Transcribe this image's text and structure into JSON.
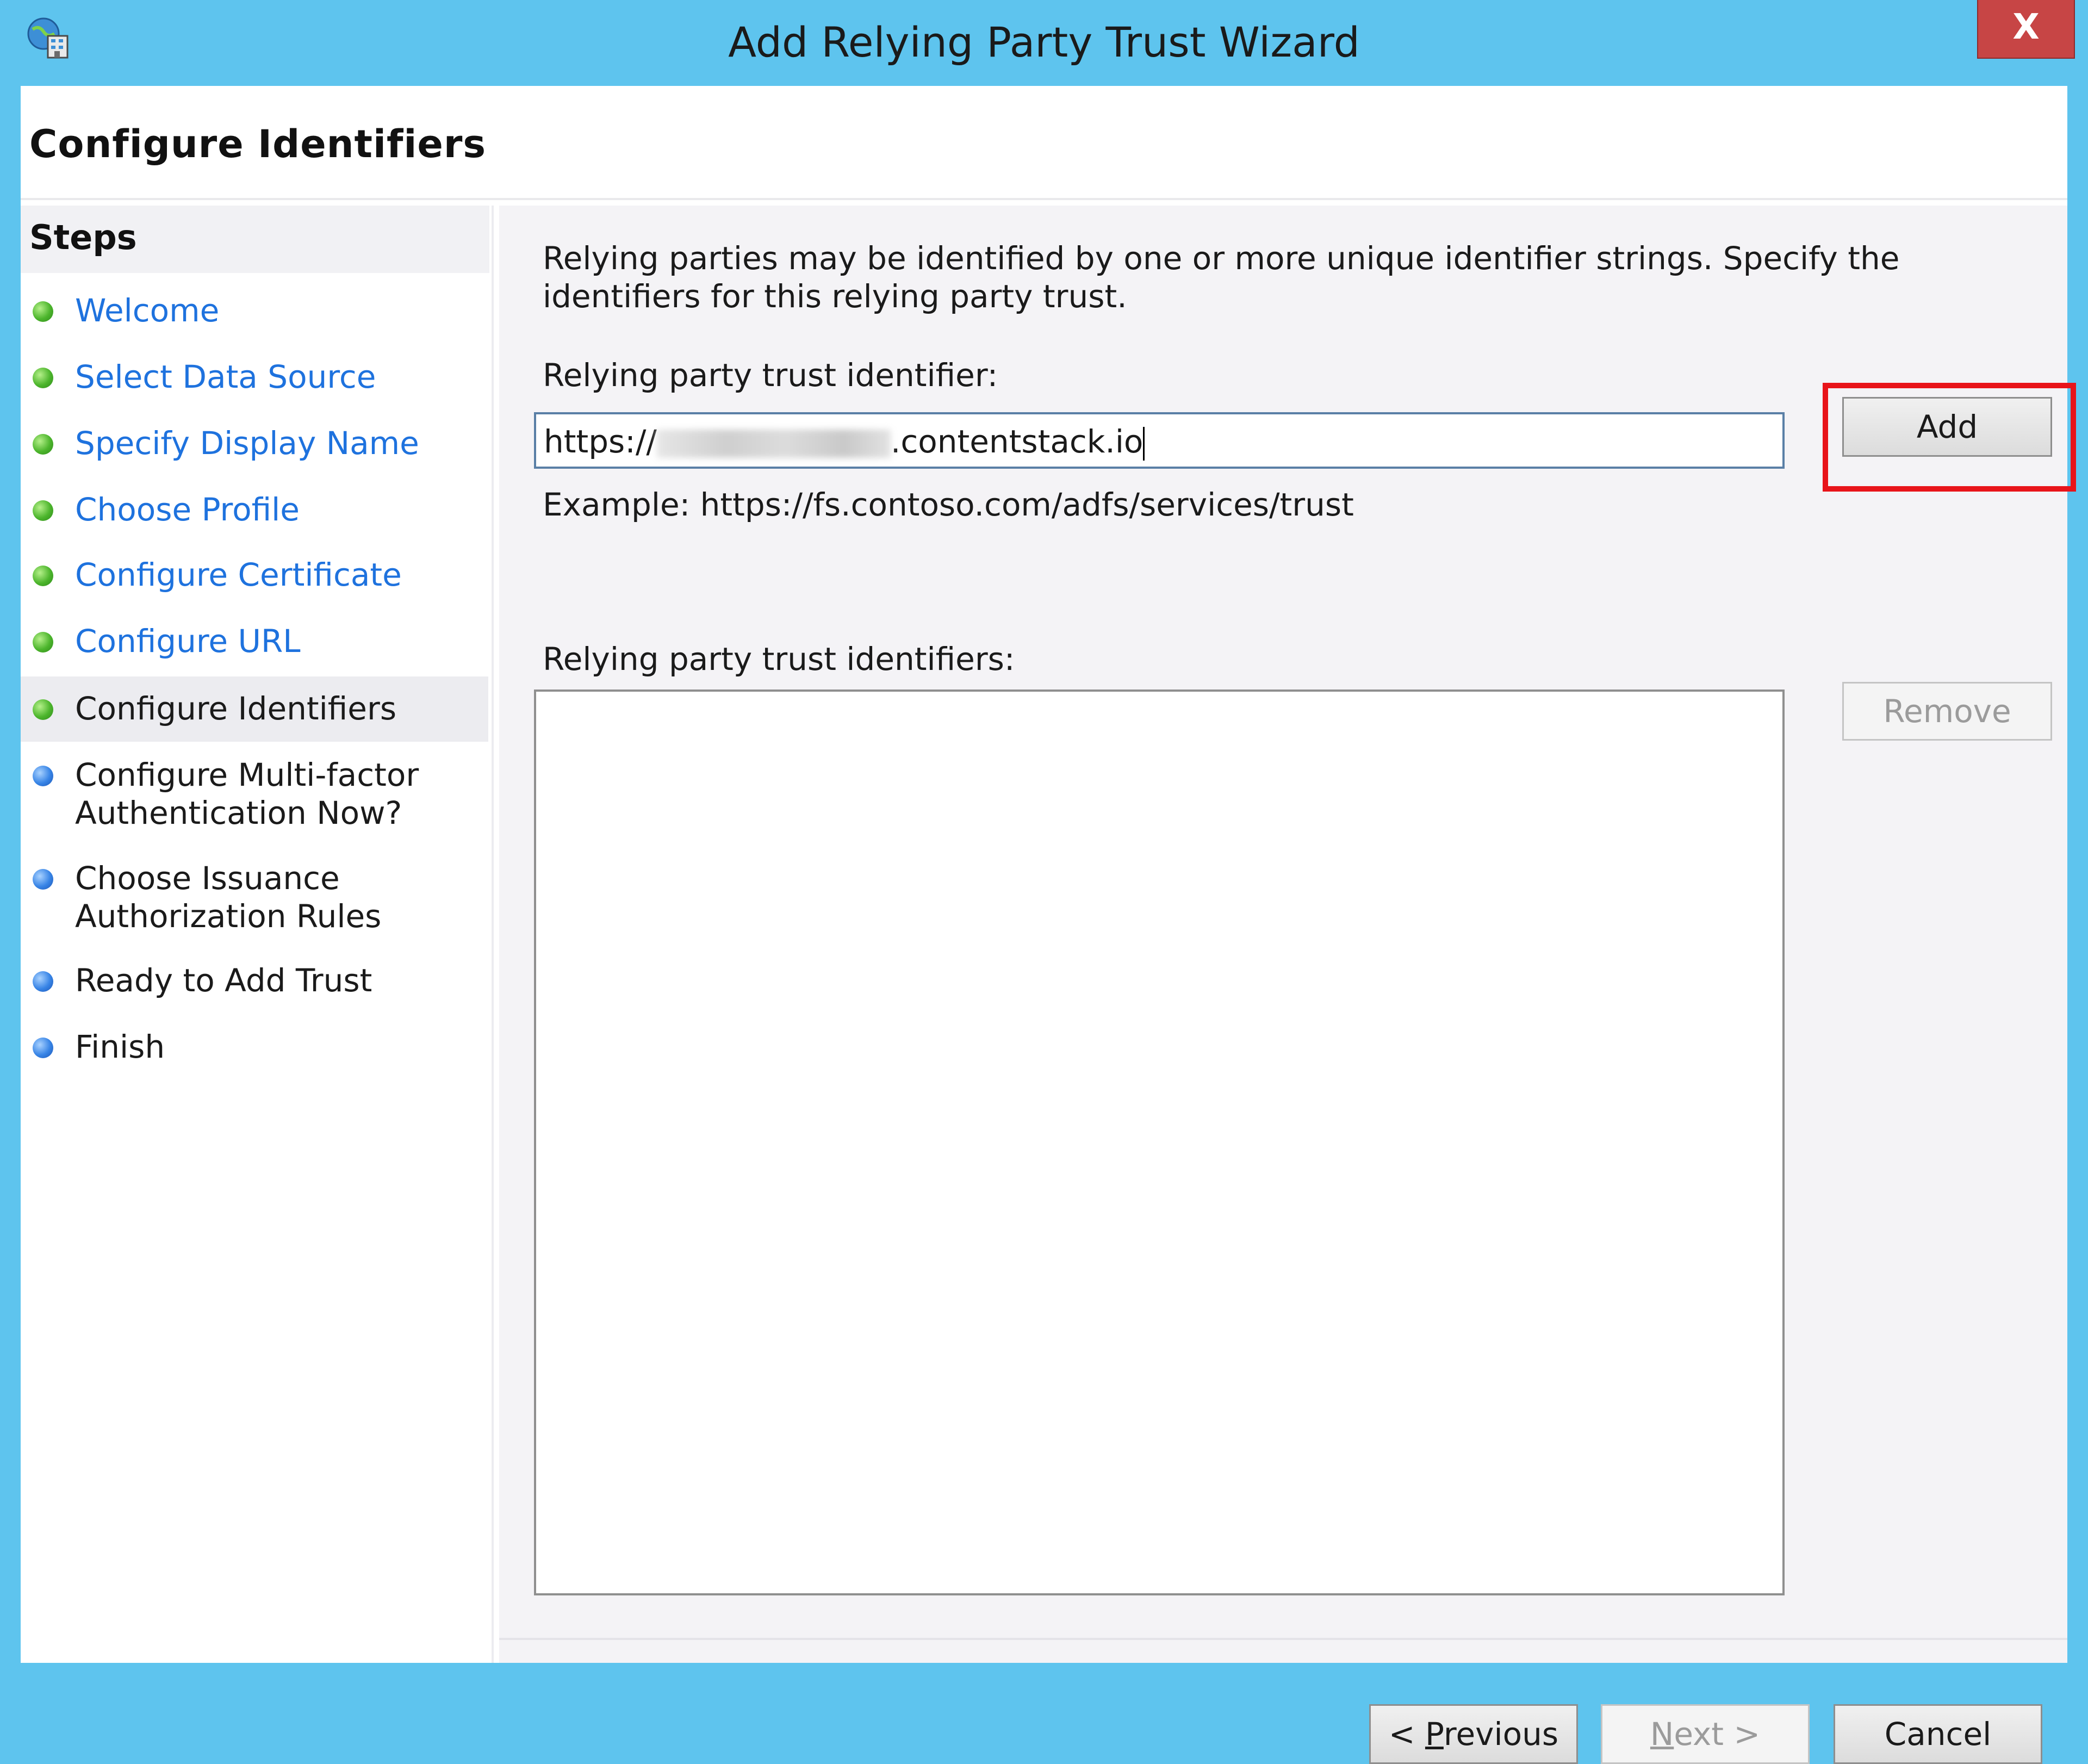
{
  "window": {
    "title": "Add Relying Party Trust Wizard",
    "close_label": "X"
  },
  "page": {
    "title": "Configure Identifiers"
  },
  "steps": {
    "heading": "Steps",
    "items": [
      {
        "label": "Welcome",
        "state": "done"
      },
      {
        "label": "Select Data Source",
        "state": "done"
      },
      {
        "label": "Specify Display Name",
        "state": "done"
      },
      {
        "label": "Choose Profile",
        "state": "done"
      },
      {
        "label": "Configure Certificate",
        "state": "done"
      },
      {
        "label": "Configure URL",
        "state": "done"
      },
      {
        "label": "Configure Identifiers",
        "state": "current"
      },
      {
        "label": "Configure Multi-factor\nAuthentication Now?",
        "state": "pending"
      },
      {
        "label": "Choose Issuance\nAuthorization Rules",
        "state": "pending"
      },
      {
        "label": "Ready to Add Trust",
        "state": "pending"
      },
      {
        "label": "Finish",
        "state": "pending"
      }
    ]
  },
  "content": {
    "description": "Relying parties may be identified by one or more unique identifier strings. Specify the identifiers for this relying party trust.",
    "identifier_label": "Relying party trust identifier:",
    "identifier_prefix": "https://",
    "identifier_suffix": ".contentstack.io",
    "example": "Example: https://fs.contoso.com/adfs/services/trust",
    "identifiers_label": "Relying party trust identifiers:",
    "identifiers": []
  },
  "buttons": {
    "add": "Add",
    "remove": "Remove",
    "previous_prefix": "< ",
    "previous_accel": "P",
    "previous_rest": "revious",
    "next_accel": "N",
    "next_rest": "ext >",
    "cancel": "Cancel"
  },
  "colors": {
    "titlebar": "#5ec4ee",
    "close": "#c74545",
    "link": "#1e72de",
    "highlight": "#e8141a",
    "step_done": "#4cb52c",
    "step_pending": "#3784e6"
  }
}
